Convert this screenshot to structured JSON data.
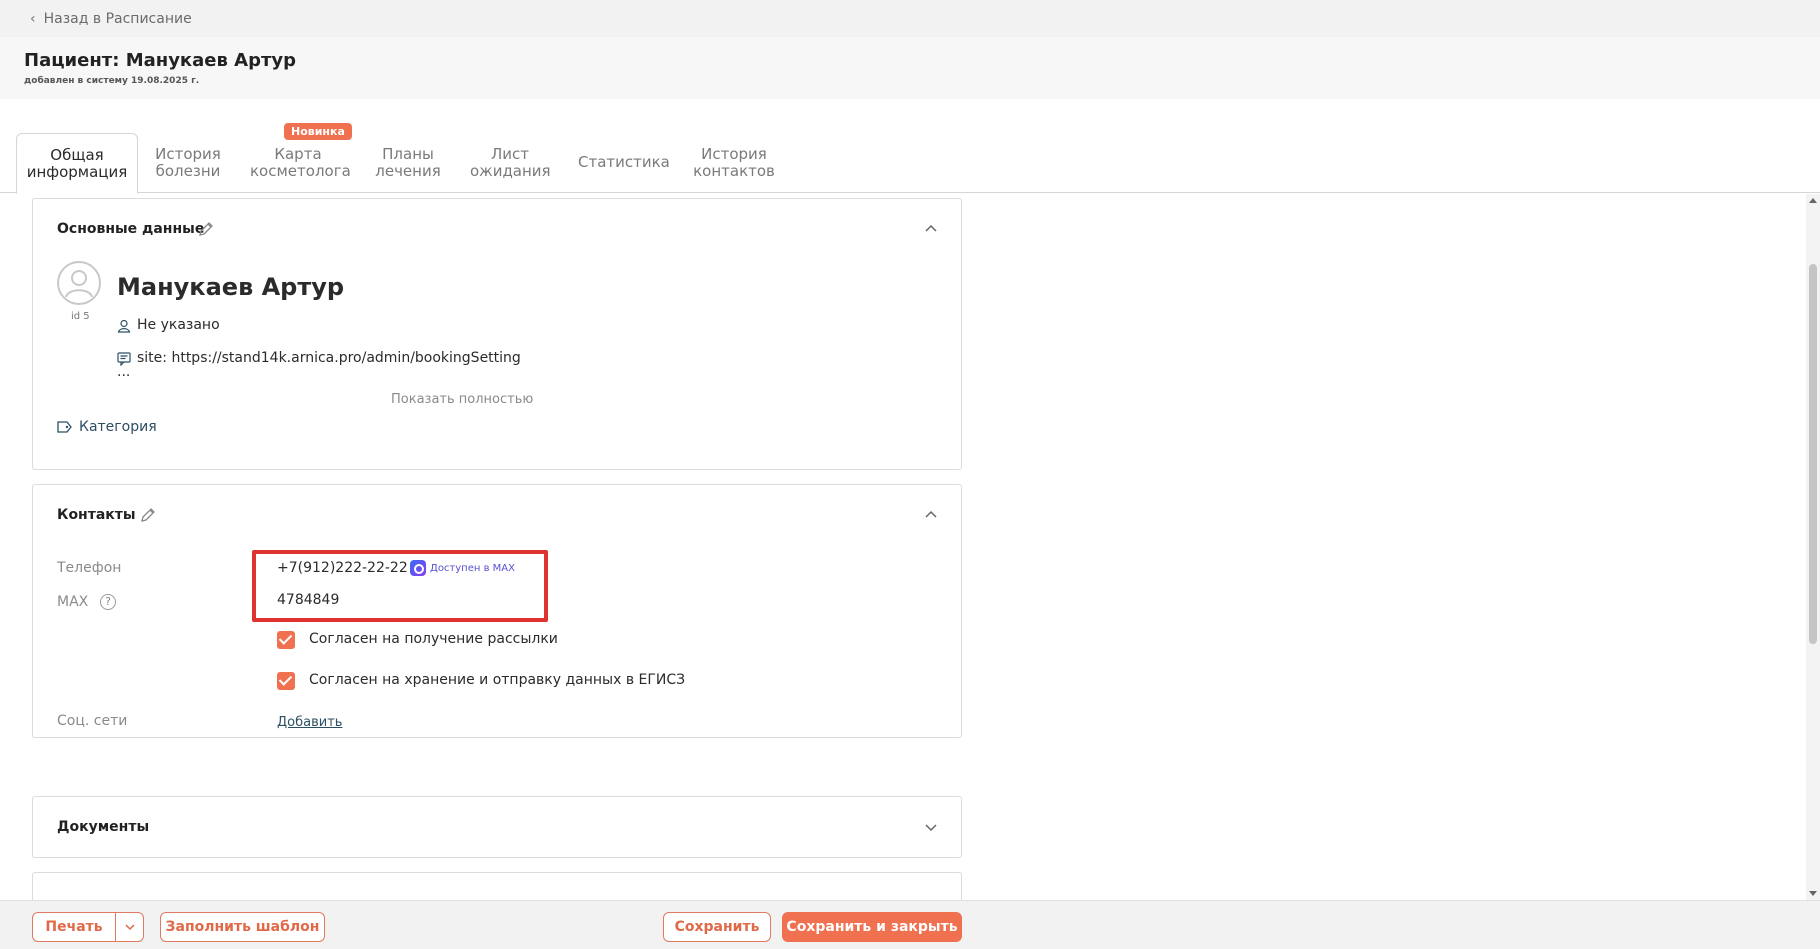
{
  "back_link": "Назад в Расписание",
  "header": {
    "title": "Пациент: Манукаев Артур",
    "subtitle": "добавлен в систему 19.08.2025 г."
  },
  "tabs": [
    {
      "line1": "Общая",
      "line2": "информация",
      "active": true
    },
    {
      "line1": "История",
      "line2": "болезни"
    },
    {
      "line1": "Карта",
      "line2": "косметолога",
      "badge": "Новинка"
    },
    {
      "line1": "Планы",
      "line2": "лечения"
    },
    {
      "line1": "Лист",
      "line2": "ожидания"
    },
    {
      "line1": "Статистика",
      "line2": ""
    },
    {
      "line1": "История",
      "line2": "контактов"
    }
  ],
  "basic": {
    "title": "Основные данные",
    "name": "Манукаев Артур",
    "id_label": "id 5",
    "gender": "Не указано",
    "comment": "site: https://stand14k.arnica.pro/admin/bookingSetting",
    "ellipsis": "...",
    "show_full": "Показать полностью",
    "category": "Категория"
  },
  "contacts": {
    "title": "Контакты",
    "phone_label": "Телефон",
    "phone": "+7(912)222-22-22",
    "max_status": "Доступен в MAX",
    "max_label": "MAX",
    "help": "?",
    "max_value": "4784849",
    "consent_mailing": "Согласен на получение рассылки",
    "consent_egisz": "Согласен на хранение и отправку данных в ЕГИСЗ",
    "social_label": "Соц. сети",
    "social_add": "Добавить"
  },
  "documents": {
    "title": "Документы"
  },
  "footer": {
    "print": "Печать",
    "fill_template": "Заполнить шаблон",
    "save": "Сохранить",
    "save_close": "Сохранить и закрыть"
  },
  "colors": {
    "accent": "#f0714f",
    "highlight": "#e0332f",
    "link": "#2c4f63"
  }
}
